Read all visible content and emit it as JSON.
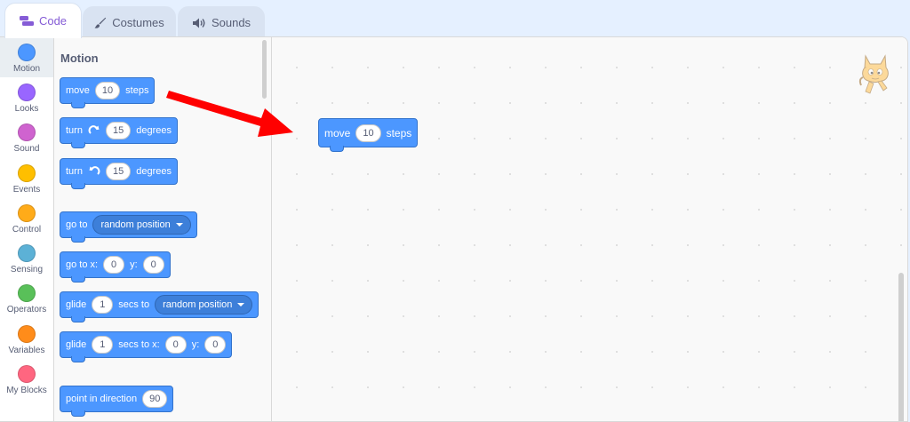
{
  "tabs": {
    "code": "Code",
    "costumes": "Costumes",
    "sounds": "Sounds"
  },
  "categories": [
    {
      "label": "Motion",
      "color": "#4c97ff"
    },
    {
      "label": "Looks",
      "color": "#9966ff"
    },
    {
      "label": "Sound",
      "color": "#cf63cf"
    },
    {
      "label": "Events",
      "color": "#ffbf00"
    },
    {
      "label": "Control",
      "color": "#ffab19"
    },
    {
      "label": "Sensing",
      "color": "#5cb1d6"
    },
    {
      "label": "Operators",
      "color": "#59c059"
    },
    {
      "label": "Variables",
      "color": "#ff8c1a"
    },
    {
      "label": "My Blocks",
      "color": "#ff6680"
    }
  ],
  "palette": {
    "title": "Motion",
    "move": {
      "label": "move",
      "value": "10",
      "suffix": "steps"
    },
    "turn_right": {
      "label": "turn",
      "value": "15",
      "suffix": "degrees"
    },
    "turn_left": {
      "label": "turn",
      "value": "15",
      "suffix": "degrees"
    },
    "goto": {
      "label": "go to",
      "option": "random position"
    },
    "goto_xy": {
      "label": "go to x:",
      "x": "0",
      "y_label": "y:",
      "y": "0"
    },
    "glide": {
      "label": "glide",
      "secs": "1",
      "mid": "secs to",
      "option": "random position"
    },
    "glide_xy": {
      "label": "glide",
      "secs": "1",
      "mid": "secs to x:",
      "x": "0",
      "y_label": "y:",
      "y": "0"
    },
    "point": {
      "label": "point in direction",
      "value": "90"
    }
  },
  "workspace": {
    "move_block": {
      "label": "move",
      "value": "10",
      "suffix": "steps"
    }
  },
  "colors": {
    "motion": "#4c97ff",
    "accent": "#855cd6",
    "arrow": "#ff0000"
  },
  "icons": [
    "code-icon",
    "brush-icon",
    "speaker-icon",
    "rotate-right-icon",
    "rotate-left-icon",
    "cat-sprite-icon"
  ]
}
